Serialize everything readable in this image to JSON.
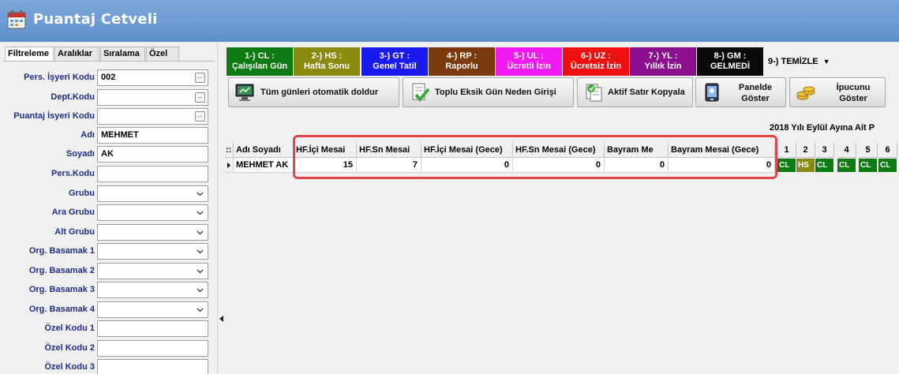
{
  "window": {
    "title": "Puantaj Cetveli"
  },
  "filter_tabs": [
    "Filtreleme",
    "Aralıklar",
    "Sıralama",
    "Özel"
  ],
  "filters": [
    {
      "label": "Pers. İşyeri Kodu",
      "value": "002",
      "control": "lookup"
    },
    {
      "label": "Dept.Kodu",
      "value": "",
      "control": "lookup"
    },
    {
      "label": "Puantaj İsyeri Kodu",
      "value": "",
      "control": "lookup"
    },
    {
      "label": "Adı",
      "value": "MEHMET",
      "control": "text"
    },
    {
      "label": "Soyadı",
      "value": "AK",
      "control": "text"
    },
    {
      "label": "Pers.Kodu",
      "value": "",
      "control": "text"
    },
    {
      "label": "Grubu",
      "value": "",
      "control": "dropdown"
    },
    {
      "label": "Ara Grubu",
      "value": "",
      "control": "dropdown"
    },
    {
      "label": "Alt Grubu",
      "value": "",
      "control": "dropdown"
    },
    {
      "label": "Org. Basamak 1",
      "value": "",
      "control": "dropdown"
    },
    {
      "label": "Org. Basamak 2",
      "value": "",
      "control": "dropdown"
    },
    {
      "label": "Org. Basamak 3",
      "value": "",
      "control": "dropdown"
    },
    {
      "label": "Org. Basamak 4",
      "value": "",
      "control": "dropdown"
    },
    {
      "label": "Özel Kodu 1",
      "value": "",
      "control": "text"
    },
    {
      "label": "Özel Kodu 2",
      "value": "",
      "control": "text"
    },
    {
      "label": "Özel Kodu 3",
      "value": "",
      "control": "text"
    }
  ],
  "legend": [
    {
      "line1": "1-) CL :",
      "line2": "Çalışılan Gün",
      "bg": "#0e7a12",
      "fg": "#ffffff"
    },
    {
      "line1": "2-) HS :",
      "line2": "Hafta Sonu",
      "bg": "#8a8a10",
      "fg": "#ffffff"
    },
    {
      "line1": "3-) GT :",
      "line2": "Genel Tatil",
      "bg": "#1a1aee",
      "fg": "#ffffff"
    },
    {
      "line1": "4-) RP :",
      "line2": "Raporlu",
      "bg": "#7a3a0c",
      "fg": "#ffffff"
    },
    {
      "line1": "5-) UL :",
      "line2": "Ücretli İzin",
      "bg": "#f21af2",
      "fg": "#ffffff"
    },
    {
      "line1": "6-) UZ :",
      "line2": "Ücretsiz İzin",
      "bg": "#ee1010",
      "fg": "#ffffff"
    },
    {
      "line1": "7-) YL :",
      "line2": "Yıllık İzin",
      "bg": "#8a1090",
      "fg": "#ffffff"
    },
    {
      "line1": "8-) GM :",
      "line2": "GELMEDİ",
      "bg": "#0a0a0a",
      "fg": "#ffffff"
    }
  ],
  "clear_label": "9-) TEMİZLE",
  "toolbar": {
    "autofill": "Tüm günleri otomatik doldur",
    "bulk_missing": "Toplu Eksik Gün Neden Girişi",
    "copy_row": "Aktif Satır Kopyala",
    "show_panel_1": "Panelde",
    "show_panel_2": "Göster",
    "show_tips_1": "İpucunu",
    "show_tips_2": "Göster"
  },
  "period_title": "2018 Yılı Eylül Ayına Ait P",
  "grid": {
    "row_handle": "::",
    "columns": [
      "Adı Soyadı",
      "HF.İçi Mesai",
      "HF.Sn Mesai",
      "HF.İçi Mesai (Gece)",
      "HF.Sn Mesai (Gece)",
      "Bayram Me",
      "Bayram Mesai (Gece)"
    ],
    "rows": [
      {
        "name": "MEHMET AK",
        "values": [
          "15",
          "7",
          "0",
          "0",
          "0",
          "0"
        ]
      }
    ],
    "days": [
      "1",
      "2",
      "3",
      "4",
      "5",
      "6"
    ],
    "day_codes": [
      {
        "code": "CL",
        "color": "#0e7a12"
      },
      {
        "code": "HS",
        "color": "#8a8a10"
      },
      {
        "code": "CL",
        "color": "#0e7a12"
      },
      {
        "code": "CL",
        "color": "#0e7a12"
      },
      {
        "code": "CL",
        "color": "#0e7a12"
      },
      {
        "code": "CL",
        "color": "#0e7a12"
      }
    ]
  },
  "icons": {
    "app": "calendar-icon",
    "autofill": "monitor-fill-icon",
    "bulk_missing": "checklist-icon",
    "copy_row": "copy-document-icon",
    "show_panel": "phone-panel-icon",
    "show_tips": "coins-tip-icon"
  }
}
